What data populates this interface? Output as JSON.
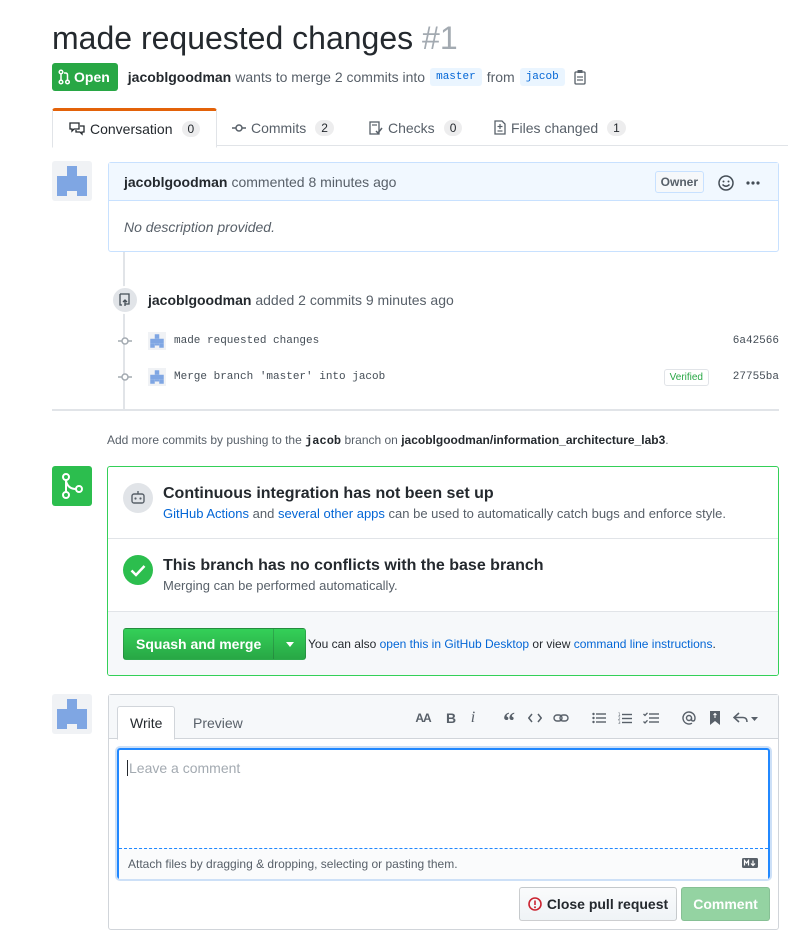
{
  "pr": {
    "title": "made requested changes",
    "number": "#1",
    "state": "Open",
    "author": "jacoblgoodman",
    "meta_text": "wants to merge 2 commits into",
    "base_branch": "master",
    "from_text": "from",
    "head_branch": "jacob"
  },
  "tabs": [
    {
      "label": "Conversation",
      "count": "0"
    },
    {
      "label": "Commits",
      "count": "2"
    },
    {
      "label": "Checks",
      "count": "0"
    },
    {
      "label": "Files changed",
      "count": "1"
    }
  ],
  "comment": {
    "author": "jacoblgoodman",
    "action": "commented 8 minutes ago",
    "role": "Owner",
    "body": "No description provided."
  },
  "timeline_event": {
    "author": "jacoblgoodman",
    "text": "added 2 commits 9 minutes ago"
  },
  "commits": [
    {
      "message": "made requested changes",
      "sha": "6a42566",
      "verified": ""
    },
    {
      "message": "Merge branch 'master' into jacob",
      "sha": "27755ba",
      "verified": "Verified"
    }
  ],
  "add_more": {
    "prefix": "Add more commits by pushing to the",
    "branch": "jacob",
    "middle": "branch on",
    "repo": "jacoblgoodman/information_architecture_lab3",
    "suffix": "."
  },
  "merge": {
    "ci_title": "Continuous integration has not been set up",
    "ci_link1": "GitHub Actions",
    "ci_and": "and",
    "ci_link2": "several other apps",
    "ci_rest": "can be used to automatically catch bugs and enforce style.",
    "conflict_title": "This branch has no conflicts with the base branch",
    "conflict_sub": "Merging can be performed automatically.",
    "squash_label": "Squash and merge",
    "also_prefix": "You can also",
    "also_link1": "open this in GitHub Desktop",
    "also_middle": "or view",
    "also_link2": "command line instructions",
    "also_suffix": "."
  },
  "editor": {
    "write_tab": "Write",
    "preview_tab": "Preview",
    "placeholder": "Leave a comment",
    "attach_text": "Attach files by dragging & dropping, selecting or pasting them.",
    "close_label": "Close pull request",
    "comment_label": "Comment",
    "toolbar": {
      "header": "AA",
      "bold": "B",
      "italic": "i",
      "quote": "“"
    }
  },
  "colors": {
    "open_green": "#28a745",
    "link_blue": "#0366d6",
    "tab_accent": "#e36209"
  }
}
